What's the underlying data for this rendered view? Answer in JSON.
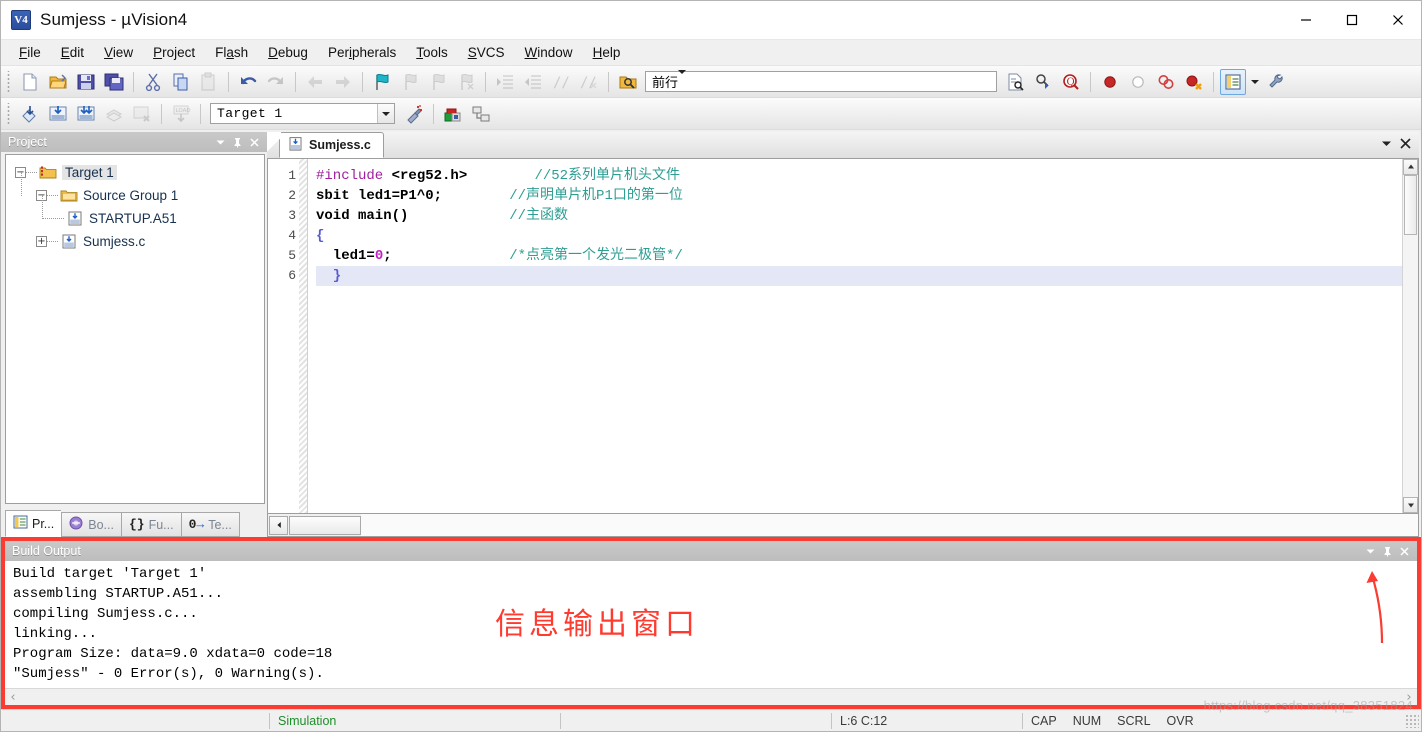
{
  "window": {
    "title": "Sumjess  - µVision4",
    "app_icon": "uvision-logo-icon",
    "minimize_label": "—",
    "maximize_label": "□",
    "close_label": "✕"
  },
  "menubar": {
    "items": [
      {
        "label": "File",
        "accel": "F"
      },
      {
        "label": "Edit",
        "accel": "E"
      },
      {
        "label": "View",
        "accel": "V"
      },
      {
        "label": "Project",
        "accel": "P"
      },
      {
        "label": "Flash",
        "accel": "a"
      },
      {
        "label": "Debug",
        "accel": "D"
      },
      {
        "label": "Peripherals",
        "accel": "i"
      },
      {
        "label": "Tools",
        "accel": "T"
      },
      {
        "label": "SVCS",
        "accel": "S"
      },
      {
        "label": "Window",
        "accel": "W"
      },
      {
        "label": "Help",
        "accel": "H"
      }
    ]
  },
  "toolbar_main": {
    "buttons": [
      "new-file-icon",
      "open-file-icon",
      "save-icon",
      "save-all-icon",
      "cut-icon",
      "copy-icon",
      "paste-icon",
      "undo-icon",
      "redo-icon",
      "navigate-back-icon",
      "navigate-forward-icon",
      "bookmark-toggle-icon",
      "bookmark-prev-icon",
      "bookmark-next-icon",
      "bookmark-clear-icon",
      "indent-icon",
      "outdent-icon",
      "comment-icon",
      "uncomment-icon"
    ],
    "find_in_files_icon": "find-in-files-icon",
    "find_value": "前行",
    "find_placeholder": "",
    "right_buttons": [
      "find-doc-icon",
      "find-next-icon",
      "find-in-project-icon",
      "breakpoint-icon",
      "breakpoint-disable-icon",
      "breakpoint-disable-all-icon",
      "breakpoint-kill-all-icon",
      "project-window-icon",
      "configure-icon"
    ]
  },
  "toolbar_build": {
    "buttons": [
      "translate-icon",
      "build-target-icon",
      "rebuild-all-icon",
      "batch-build-icon",
      "stop-build-icon",
      "download-icon"
    ],
    "target_value": "Target 1",
    "after_buttons": [
      "target-options-icon",
      "manage-components-icon",
      "manage-multi-project-icon"
    ]
  },
  "project_panel": {
    "title": "Project",
    "header_buttons": [
      "chevron-down-icon",
      "pin-icon",
      "close-icon"
    ],
    "tree": [
      {
        "label": "Target 1",
        "depth": 0,
        "expander": "−",
        "icon": "target-folder-icon",
        "selected": true
      },
      {
        "label": "Source Group 1",
        "depth": 1,
        "expander": "−",
        "icon": "group-folder-icon",
        "selected": false
      },
      {
        "label": "STARTUP.A51",
        "depth": 2,
        "expander": "",
        "icon": "source-file-icon",
        "selected": false
      },
      {
        "label": "Sumjess.c",
        "depth": 2,
        "expander": "+",
        "icon": "source-file-icon",
        "selected": false
      }
    ],
    "tabs": [
      {
        "label": "Pr...",
        "icon": "project-icon",
        "active": true
      },
      {
        "label": "Bo...",
        "icon": "books-icon",
        "active": false
      },
      {
        "label": "Fu...",
        "icon": "functions-icon",
        "active": false
      },
      {
        "label": "Te...",
        "icon": "templates-icon",
        "active": false
      }
    ]
  },
  "editor": {
    "tab": {
      "label": "Sumjess.c",
      "icon": "source-file-icon"
    },
    "header_buttons": [
      "chevron-down-icon",
      "close-icon"
    ],
    "line_numbers": [
      "1",
      "2",
      "3",
      "4",
      "5",
      "6"
    ],
    "lines": [
      {
        "n": 1,
        "highlight": false,
        "tokens": [
          {
            "t": "#include",
            "c": "kw-pre"
          },
          {
            "t": " <reg52.h>",
            "c": "kw-plain"
          },
          {
            "t": "        ",
            "c": "kw-plain"
          },
          {
            "t": "//52系列单片机头文件",
            "c": "kw-cmt"
          }
        ]
      },
      {
        "n": 2,
        "highlight": false,
        "tokens": [
          {
            "t": "sbit led1=P1^0;",
            "c": "kw-plain"
          },
          {
            "t": "        ",
            "c": "kw-plain"
          },
          {
            "t": "//声明单片机P1口的第一位",
            "c": "kw-cmt"
          }
        ]
      },
      {
        "n": 3,
        "highlight": false,
        "tokens": [
          {
            "t": "void main()",
            "c": "kw-plain"
          },
          {
            "t": "            ",
            "c": "kw-plain"
          },
          {
            "t": "//主函数",
            "c": "kw-cmt"
          }
        ]
      },
      {
        "n": 4,
        "highlight": false,
        "tokens": [
          {
            "t": "{",
            "c": "kw-brace"
          }
        ]
      },
      {
        "n": 5,
        "highlight": false,
        "tokens": [
          {
            "t": "  led1=",
            "c": "kw-plain"
          },
          {
            "t": "0",
            "c": "kw-num"
          },
          {
            "t": ";",
            "c": "kw-plain"
          },
          {
            "t": "              ",
            "c": "kw-plain"
          },
          {
            "t": "/*点亮第一个发光二极管*/",
            "c": "kw-cmt"
          }
        ]
      },
      {
        "n": 6,
        "highlight": true,
        "tokens": [
          {
            "t": "  }",
            "c": "kw-brace"
          }
        ]
      }
    ]
  },
  "build_output": {
    "title": "Build Output",
    "header_buttons": [
      "chevron-down-icon",
      "pin-icon",
      "close-icon"
    ],
    "lines": [
      "Build target 'Target 1'",
      "assembling STARTUP.A51...",
      "compiling Sumjess.c...",
      "linking...",
      "Program Size: data=9.0 xdata=0 code=18",
      "\"Sumjess\" - 0 Error(s), 0 Warning(s)."
    ],
    "annotation": "信息输出窗口",
    "annotation_color": "#ff3b30",
    "highlight_border_color": "#fa3c32",
    "scroll_left_icon": "chevron-left-icon",
    "scroll_right_icon": "chevron-right-icon"
  },
  "statusbar": {
    "simulation": "Simulation",
    "simulation_color": "#1d8f2a",
    "cursor_position": "L:6 C:12",
    "indicators": [
      "CAP",
      "NUM",
      "SCRL",
      "OVR"
    ],
    "watermark": "https://blog.csdn.net/qq_38351824"
  }
}
